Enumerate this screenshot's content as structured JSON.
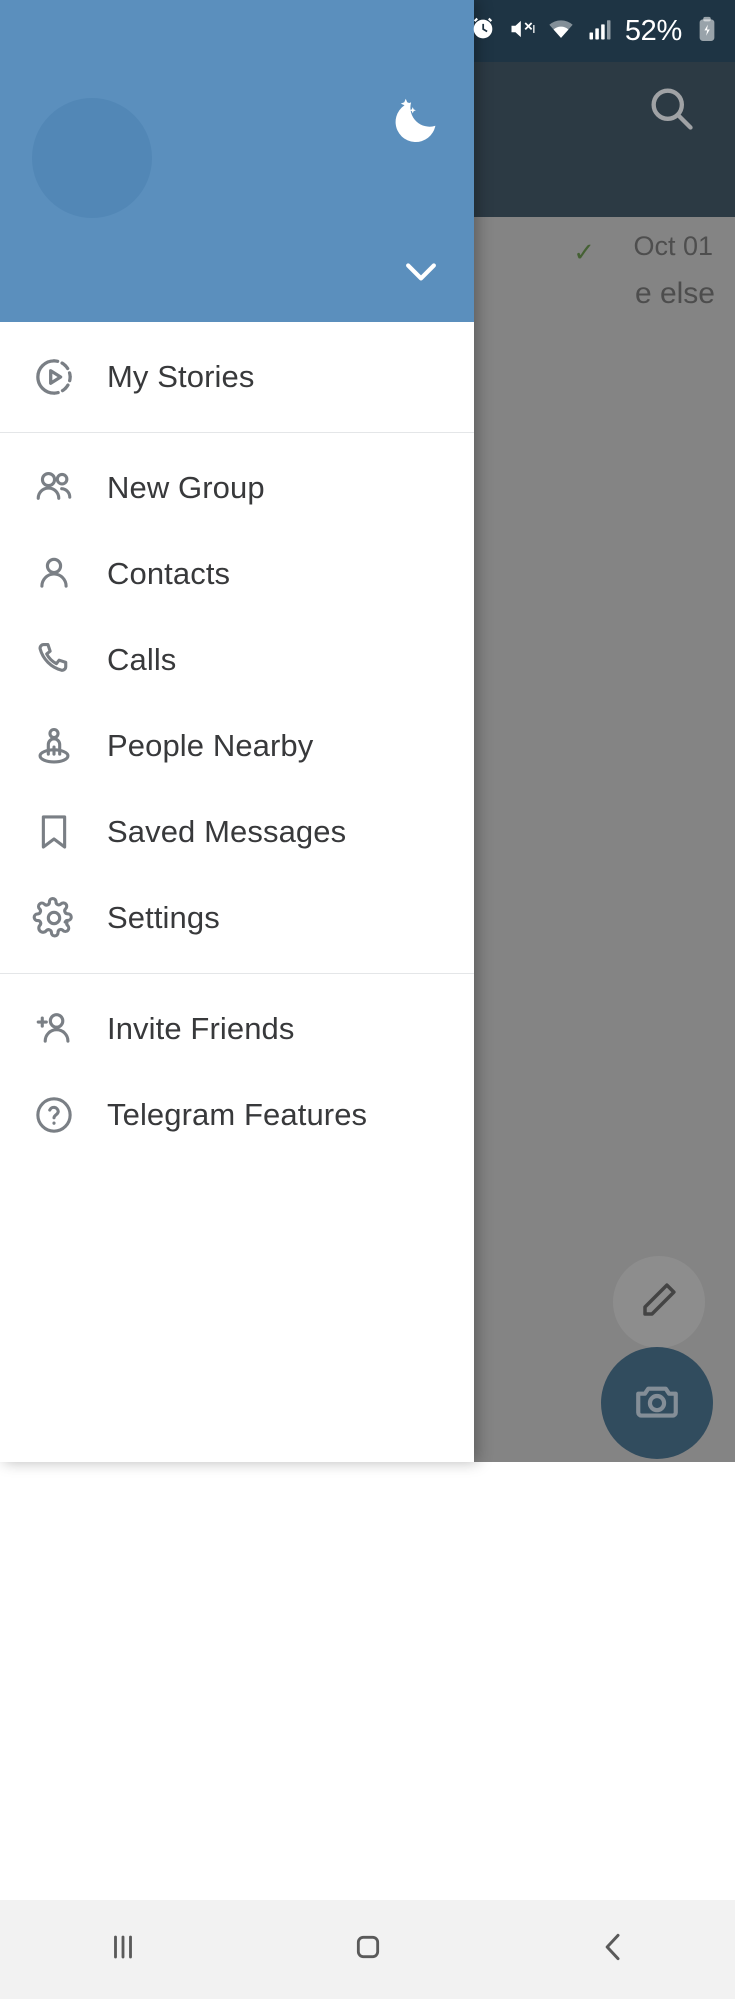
{
  "status_bar": {
    "battery_percent": "52%",
    "icons": [
      "alarm-icon",
      "vibrate-mute-icon",
      "wifi-icon",
      "cellular-signal-icon",
      "battery-charging-icon"
    ]
  },
  "background_app": {
    "search_icon": "search-icon",
    "chat_rows": [
      {
        "date": "Oct 01",
        "check": "✓",
        "preview": "e else"
      }
    ],
    "fab_edit_icon": "pencil-icon",
    "fab_camera_icon": "camera-icon"
  },
  "drawer": {
    "header": {
      "avatar": "user-avatar",
      "night_mode_icon": "moon-icon",
      "expand_icon": "chevron-down-icon"
    },
    "groups": [
      {
        "items": [
          {
            "label": "My Stories",
            "icon": "stories-play-circle-icon"
          }
        ]
      },
      {
        "items": [
          {
            "label": "New Group",
            "icon": "people-group-icon"
          },
          {
            "label": "Contacts",
            "icon": "person-icon"
          },
          {
            "label": "Calls",
            "icon": "phone-icon"
          },
          {
            "label": "People Nearby",
            "icon": "people-nearby-icon"
          },
          {
            "label": "Saved Messages",
            "icon": "bookmark-icon"
          },
          {
            "label": "Settings",
            "icon": "gear-icon"
          }
        ]
      },
      {
        "items": [
          {
            "label": "Invite Friends",
            "icon": "person-add-icon"
          },
          {
            "label": "Telegram Features",
            "icon": "question-circle-icon"
          }
        ]
      }
    ]
  },
  "nav_bar": {
    "buttons": [
      {
        "name": "recents-button",
        "icon": "recents-bars-icon"
      },
      {
        "name": "home-button",
        "icon": "home-square-icon"
      },
      {
        "name": "back-button",
        "icon": "back-chevron-icon"
      }
    ]
  },
  "colors": {
    "drawer_header_blue": "#5b8fbd",
    "app_bar_dark": "#22394a",
    "status_bar_dark": "#1e3444",
    "icon_gray": "#7a7f85",
    "label_dark": "#38393b",
    "fab_camera_blue": "#2a5878"
  }
}
